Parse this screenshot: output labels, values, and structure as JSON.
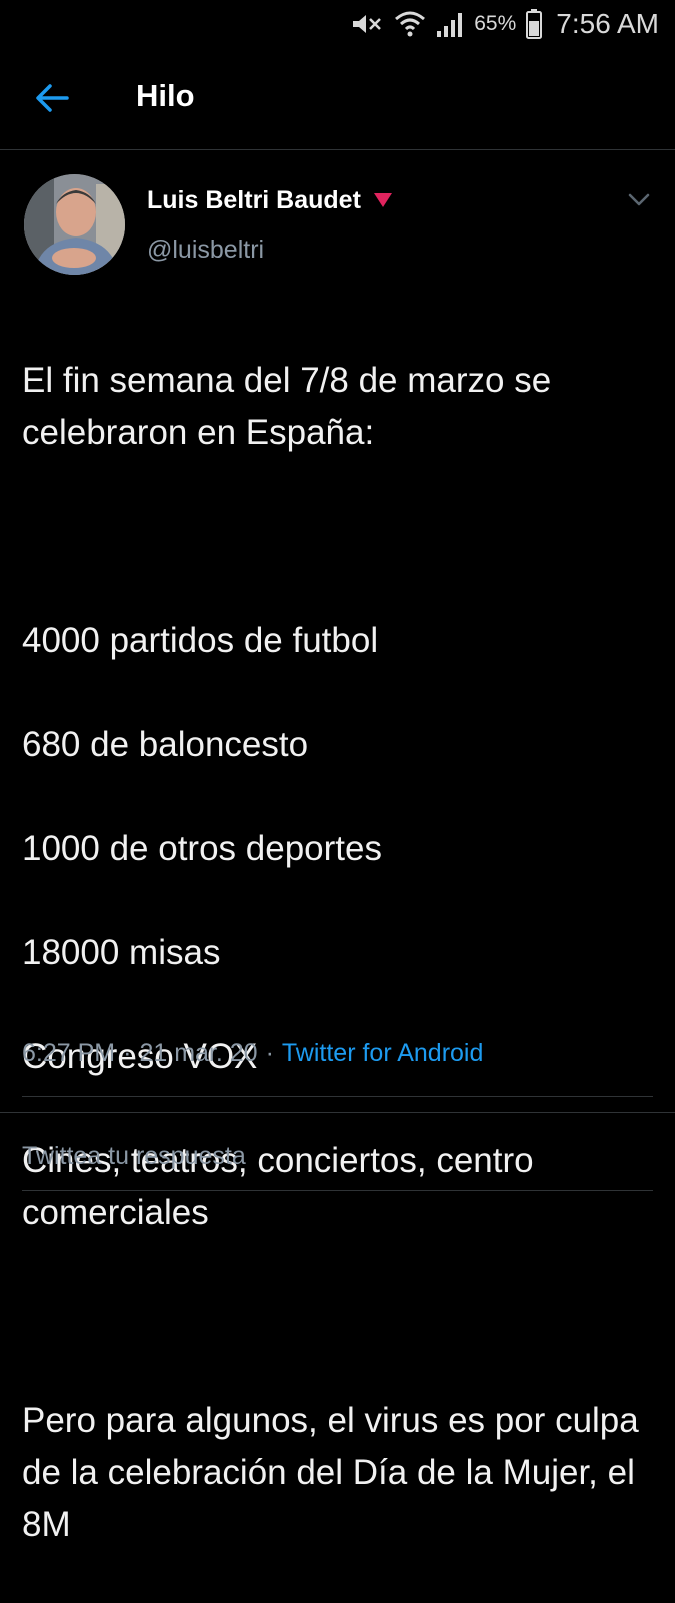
{
  "status_bar": {
    "battery_percent": "65%",
    "time": "7:56 AM",
    "icons": [
      "mute-icon",
      "wifi-icon",
      "signal-icon",
      "battery-icon"
    ]
  },
  "header": {
    "back_icon": "arrow-left-icon",
    "title": "Hilo"
  },
  "tweet": {
    "author_name": "Luis Beltri Baudet",
    "author_handle": "@luisbeltri",
    "author_marker": "red-triangle-icon",
    "paragraphs": [
      [
        "El fin semana del 7/8 de marzo se celebraron en España:"
      ],
      [
        "4000 partidos de futbol",
        "680 de baloncesto",
        "1000 de otros deportes",
        "18000 misas",
        "Congreso VOX",
        "Cines, teatros, conciertos, centro comerciales"
      ],
      [
        "Pero para algunos, el virus es por culpa de la celebración del Día de la Mujer, el 8M"
      ]
    ],
    "time": "6:27 PM",
    "date": "21 mar. 20",
    "separator": "·",
    "source": "Twitter for Android"
  },
  "reply": {
    "placeholder": "Twittea tu respuesta"
  },
  "colors": {
    "background": "#000000",
    "accent": "#1d9bf0",
    "secondary_text": "#8b98a5",
    "marker": "#e0245e"
  }
}
